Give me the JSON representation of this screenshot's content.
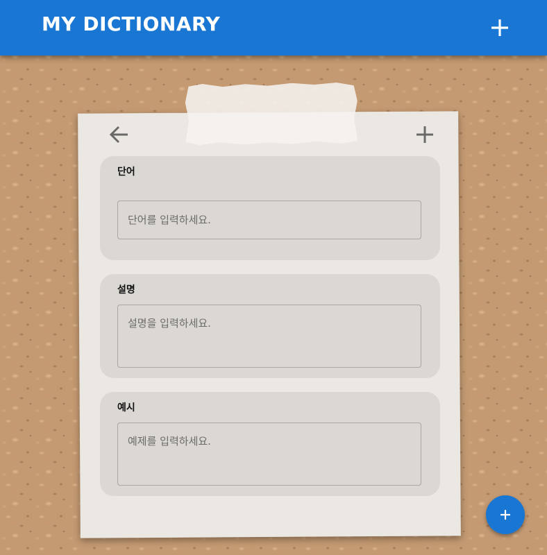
{
  "app_bar": {
    "title": "MY DICTIONARY",
    "add_icon": "plus-icon",
    "color": "#1976d2"
  },
  "note": {
    "back_icon": "arrow-left-icon",
    "add_icon": "plus-icon",
    "fields": [
      {
        "label": "단어",
        "placeholder": "단어를 입력하세요.",
        "value": ""
      },
      {
        "label": "설명",
        "placeholder": "설명을 입력하세요.",
        "value": ""
      },
      {
        "label": "예시",
        "placeholder": "예제를 입력하세요.",
        "value": ""
      }
    ]
  },
  "fab": {
    "icon": "plus-icon",
    "color": "#1976d2"
  }
}
